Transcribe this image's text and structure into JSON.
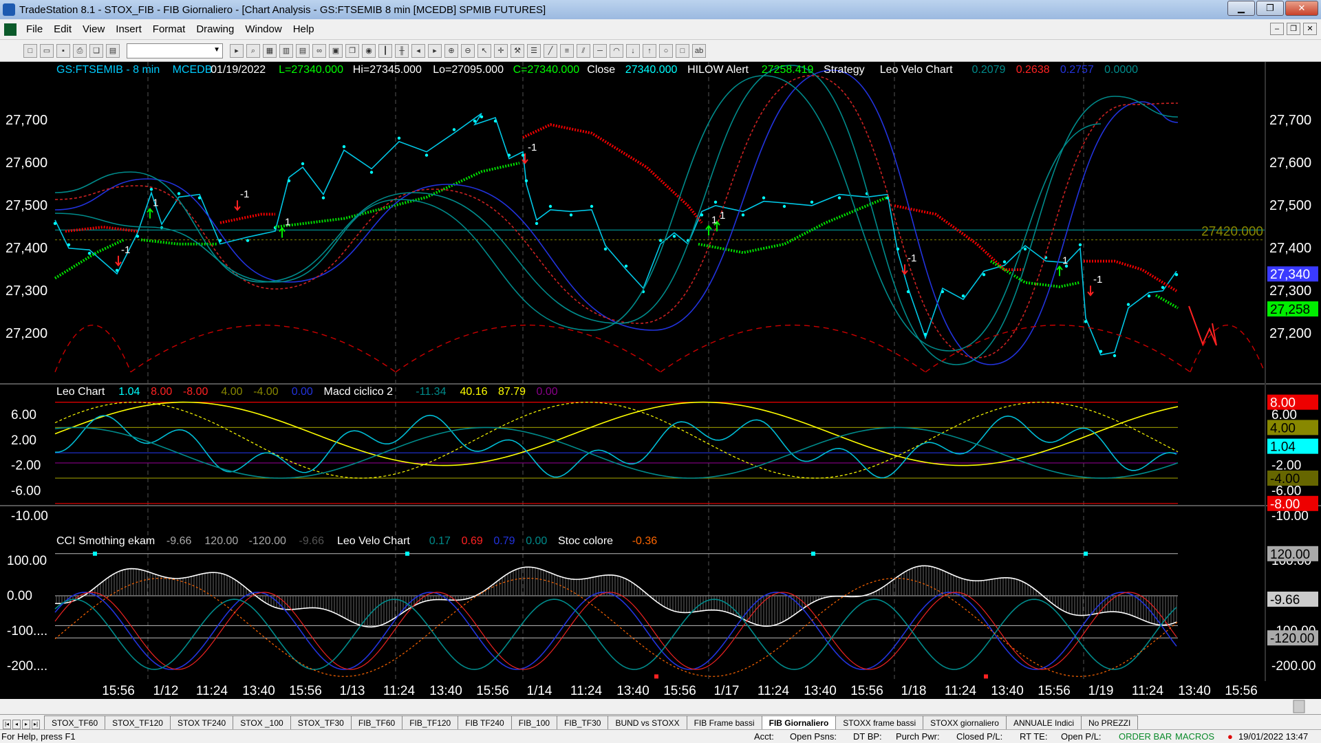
{
  "window": {
    "title": "TradeStation 8.1 - STOX_FIB - FIB Giornaliero - [Chart Analysis - GS:FTSEMIB  8 min  [MCEDB] SPMIB FUTURES]",
    "minimize": "▁",
    "maximize": "❐",
    "close": "✕"
  },
  "menu": [
    "File",
    "Edit",
    "View",
    "Insert",
    "Format",
    "Drawing",
    "Window",
    "Help"
  ],
  "toolbar_icons": [
    "new",
    "open",
    "save",
    "print",
    "copy",
    "paste",
    "cut",
    "find",
    "chart",
    "grid",
    "zoom-in",
    "zoom-out",
    "cursor",
    "tools",
    "draw-line",
    "text"
  ],
  "colors": {
    "background": "#000000",
    "price": "#00e5ff",
    "bull": "#00dd00",
    "bear": "#ee0000",
    "yellow": "#ffff00",
    "blue": "#2233dd",
    "teal": "#008b8b"
  },
  "price_panel": {
    "header": [
      {
        "text": "GS:FTSEMIB - 8 min",
        "color": "#00ccff"
      },
      {
        "text": "MCEDB",
        "color": "#00ccff"
      },
      {
        "text": "01/19/2022",
        "color": "#ffffff"
      },
      {
        "text": "L=27340.000",
        "color": "#00ff00"
      },
      {
        "text": "Hi=27345.000",
        "color": "#ffffff"
      },
      {
        "text": "Lo=27095.000",
        "color": "#ffffff"
      },
      {
        "text": "C=27340.000",
        "color": "#00ff00"
      },
      {
        "text": "Close",
        "color": "#ffffff"
      },
      {
        "text": "27340.000",
        "color": "#00ffff"
      },
      {
        "text": "HILOW Alert",
        "color": "#ffffff"
      },
      {
        "text": "27258.419",
        "color": "#00ff00"
      },
      {
        "text": "Strategy",
        "color": "#ffffff"
      },
      {
        "text": "Leo Velo Chart",
        "color": "#ffffff"
      },
      {
        "text": "0.2079",
        "color": "#008b8b"
      },
      {
        "text": "0.2638",
        "color": "#ff2222"
      },
      {
        "text": "0.2757",
        "color": "#2233dd"
      },
      {
        "text": "0.0000",
        "color": "#008b8b"
      }
    ],
    "y_labels": [
      "27,700",
      "27,600",
      "27,500",
      "27,400",
      "27,300",
      "27,200"
    ],
    "level_label": "27420.000",
    "right_badges": [
      {
        "text": "27,340",
        "bg": "#3a3aff",
        "fg": "#ffffff"
      },
      {
        "text": "27,258",
        "bg": "#00ee00",
        "fg": "#000000"
      }
    ],
    "trade_markers": [
      "-1",
      "1",
      "-1",
      "1",
      "-1",
      "1",
      "1",
      "-1",
      "1",
      "-1"
    ]
  },
  "macd_panel": {
    "header": [
      {
        "text": "Leo Chart",
        "color": "#ffffff"
      },
      {
        "text": "1.04",
        "color": "#00ffff"
      },
      {
        "text": "8.00",
        "color": "#ff2222"
      },
      {
        "text": "-8.00",
        "color": "#ff2222"
      },
      {
        "text": "4.00",
        "color": "#888800"
      },
      {
        "text": "-4.00",
        "color": "#888800"
      },
      {
        "text": "0.00",
        "color": "#2233dd"
      },
      {
        "text": "Macd ciclico 2",
        "color": "#ffffff"
      },
      {
        "text": "-11.34",
        "color": "#008b8b"
      },
      {
        "text": "40.16",
        "color": "#ffff00"
      },
      {
        "text": "87.79",
        "color": "#ffff00"
      },
      {
        "text": "0.00",
        "color": "#880088"
      }
    ],
    "y_labels": [
      "6.00",
      "2.00",
      "-2.00",
      "-6.00",
      "-10.00"
    ],
    "right_y_labels": [
      "6.00",
      "-2.00",
      "-6.00",
      "-10.00"
    ],
    "right_badges": [
      {
        "text": "8.00",
        "bg": "#ee0000",
        "fg": "#ffffff"
      },
      {
        "text": "4.00",
        "bg": "#888800",
        "fg": "#000000"
      },
      {
        "text": "1.04",
        "bg": "#00ffff",
        "fg": "#000000"
      },
      {
        "text": "-4.00",
        "bg": "#666600",
        "fg": "#000000"
      },
      {
        "text": "-8.00",
        "bg": "#ee0000",
        "fg": "#ffffff"
      }
    ]
  },
  "cci_panel": {
    "header": [
      {
        "text": "CCI Smothing ekam",
        "color": "#ffffff"
      },
      {
        "text": "-9.66",
        "color": "#aaaaaa"
      },
      {
        "text": "120.00",
        "color": "#aaaaaa"
      },
      {
        "text": "-120.00",
        "color": "#aaaaaa"
      },
      {
        "text": "-9.66",
        "color": "#555555"
      },
      {
        "text": "Leo Velo Chart",
        "color": "#ffffff"
      },
      {
        "text": "0.17",
        "color": "#008b8b"
      },
      {
        "text": "0.69",
        "color": "#ff2222"
      },
      {
        "text": "0.79",
        "color": "#2233dd"
      },
      {
        "text": "0.00",
        "color": "#008b8b"
      },
      {
        "text": "Stoc colore",
        "color": "#ffffff"
      },
      {
        "text": "-0.36",
        "color": "#ff6600"
      }
    ],
    "y_labels": [
      "100.00",
      "0.00",
      "-100....",
      "-200...."
    ],
    "right_badges": [
      {
        "text": "120.00",
        "bg": "#aaaaaa",
        "fg": "#000000"
      },
      {
        "text": "-9.66",
        "bg": "#cccccc",
        "fg": "#000000"
      },
      {
        "text": "-120.00",
        "bg": "#aaaaaa",
        "fg": "#000000"
      }
    ],
    "right_y_labels": [
      "100.00",
      "-100.00",
      "-200.00"
    ]
  },
  "x_axis_labels": [
    "15:56",
    "1/12",
    "11:24",
    "13:40",
    "15:56",
    "1/13",
    "11:24",
    "13:40",
    "15:56",
    "1/14",
    "11:24",
    "13:40",
    "15:56",
    "1/17",
    "11:24",
    "13:40",
    "15:56",
    "1/18",
    "11:24",
    "13:40",
    "15:56",
    "1/19",
    "11:24",
    "13:40",
    "15:56"
  ],
  "tabs": [
    "STOX_TF60",
    "STOX_TF120",
    "STOX TF240",
    "STOX _100",
    "STOX_TF30",
    "FIB_TF60",
    "FIB_TF120",
    "FIB TF240",
    "FIB_100",
    "FIB_TF30",
    "BUND vs STOXX",
    "FIB Frame bassi",
    "FIB Giornaliero",
    "STOXX frame bassi",
    "STOXX giornaliero",
    "ANNUALE Indici",
    "No PREZZI"
  ],
  "active_tab": "FIB Giornaliero",
  "status": {
    "help": "For Help, press F1",
    "acct": "Acct:",
    "open_psns": "Open Psns:",
    "dt_bp": "DT BP:",
    "purch_pwr": "Purch Pwr:",
    "closed_pl": "Closed P/L:",
    "rt_te": "RT TE:",
    "open_pl": "Open P/L:",
    "order_bar": "ORDER BAR",
    "macros": "MACROS",
    "datetime": "19/01/2022 13:47"
  }
}
